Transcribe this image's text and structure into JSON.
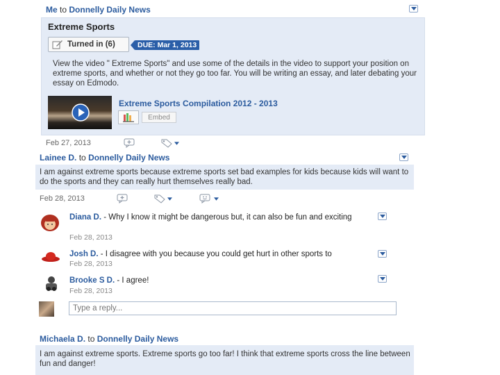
{
  "post1": {
    "sender": "Me",
    "to_word": "to",
    "group": "Donnelly Daily News",
    "assignment_title": "Extreme Sports",
    "turned_in_label": "Turned in (6)",
    "due_label": "DUE:",
    "due_date": "Mar 1, 2013",
    "description": "View the video \" Extreme Sports\" and use some of the details in the video to support your position on extreme sports, and whether or not they go too far. You will be writing an essay, and later debating your essay on Edmodo.",
    "attachment_title": "Extreme Sports Compilation 2012 - 2013",
    "embed_label": "Embed",
    "date": "Feb 27, 2013"
  },
  "post2": {
    "sender": "Lainee D.",
    "to_word": "to",
    "group": "Donnelly Daily News",
    "message": "I am against extreme sports because extreme sports set bad examples for kids because kids will want to do the sports and they can really hurt themselves really bad.",
    "date": "Feb 28, 2013",
    "replies": [
      {
        "name": "Diana D.",
        "sep": " - ",
        "text": "Why I know it might be dangerous but, it can also be fun and exciting",
        "date": "Feb 28, 2013"
      },
      {
        "name": "Josh D.",
        "sep": " - ",
        "text": "I disagree with you because you could get hurt in other sports to",
        "date": "Feb 28, 2013"
      },
      {
        "name": "Brooke S D.",
        "sep": " - ",
        "text": "I agree!",
        "date": "Feb 28, 2013"
      }
    ],
    "reply_placeholder": "Type a reply..."
  },
  "post3": {
    "sender": "Michaela D.",
    "to_word": "to",
    "group": "Donnelly Daily News",
    "message": "I am against extreme sports. Extreme sports go too far! I think that extreme sports cross the line between fun and danger!"
  },
  "colors": {
    "link": "#2b5b9e",
    "panel": "#e4ebf6",
    "due_badge": "#2a5ea8"
  }
}
